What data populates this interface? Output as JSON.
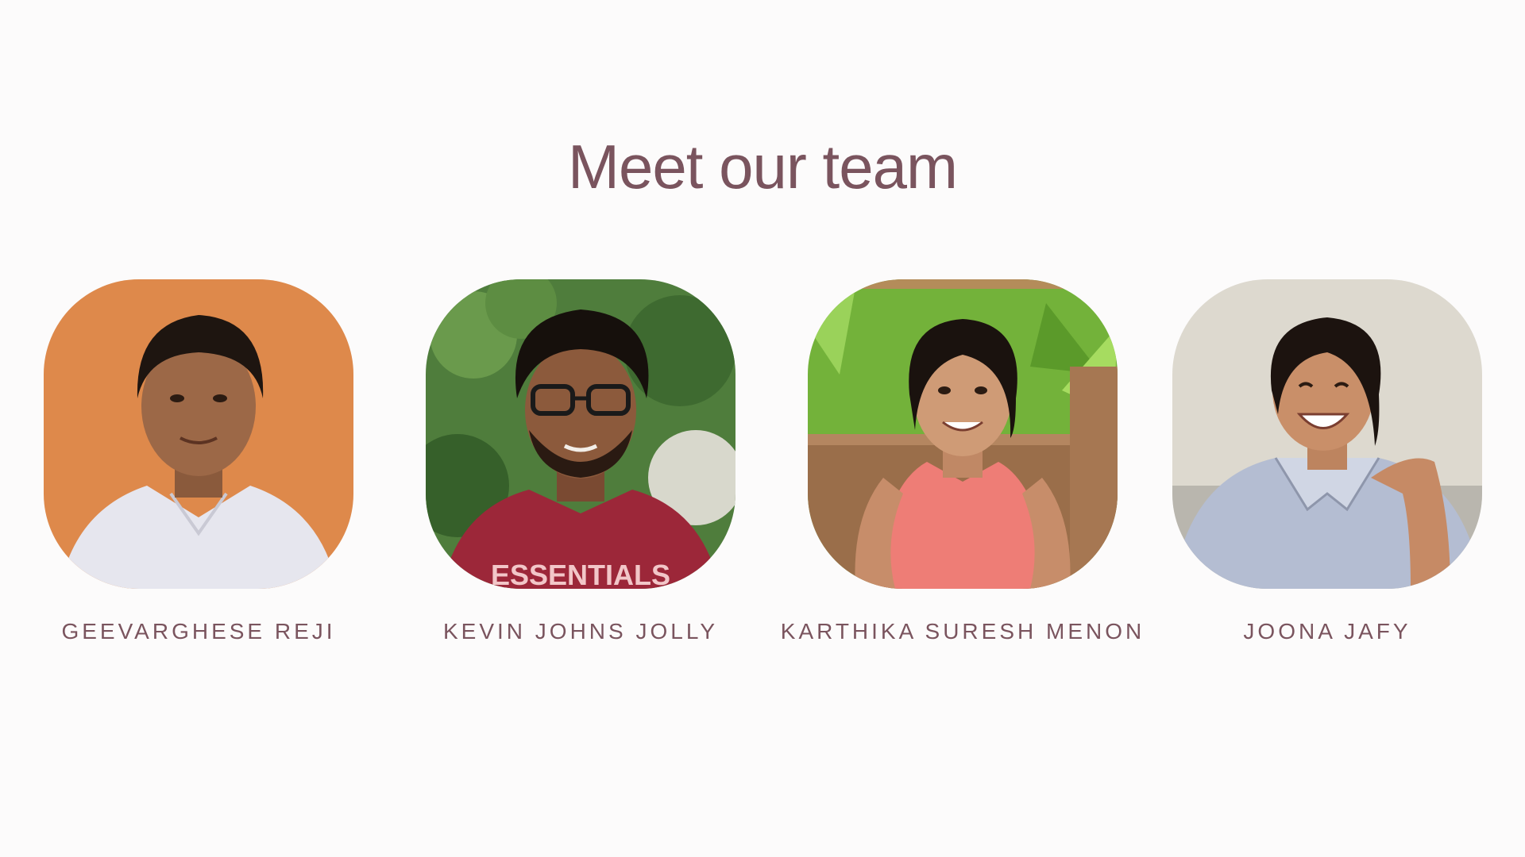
{
  "page": {
    "title": "Meet our team"
  },
  "team": [
    {
      "name": "GEEVARGHESE REJI",
      "photo_icon": "portrait-photo",
      "background_color": "#e08e4f",
      "shirt_color": "#e6e6ee"
    },
    {
      "name": "KEVIN JOHNS JOLLY",
      "photo_icon": "portrait-photo",
      "background_color": "#4f7d3c",
      "shirt_color": "#9c2739"
    },
    {
      "name": "KARTHIKA SURESH MENON",
      "photo_icon": "portrait-photo",
      "background_color": "#73b23a",
      "shirt_color": "#ee7d76"
    },
    {
      "name": "JOONA JAFY",
      "photo_icon": "portrait-photo",
      "background_color": "#ddd9cf",
      "shirt_color": "#b4bdd2"
    }
  ],
  "colors": {
    "accent": "#7a545e",
    "page_background": "#fcfbfb"
  }
}
